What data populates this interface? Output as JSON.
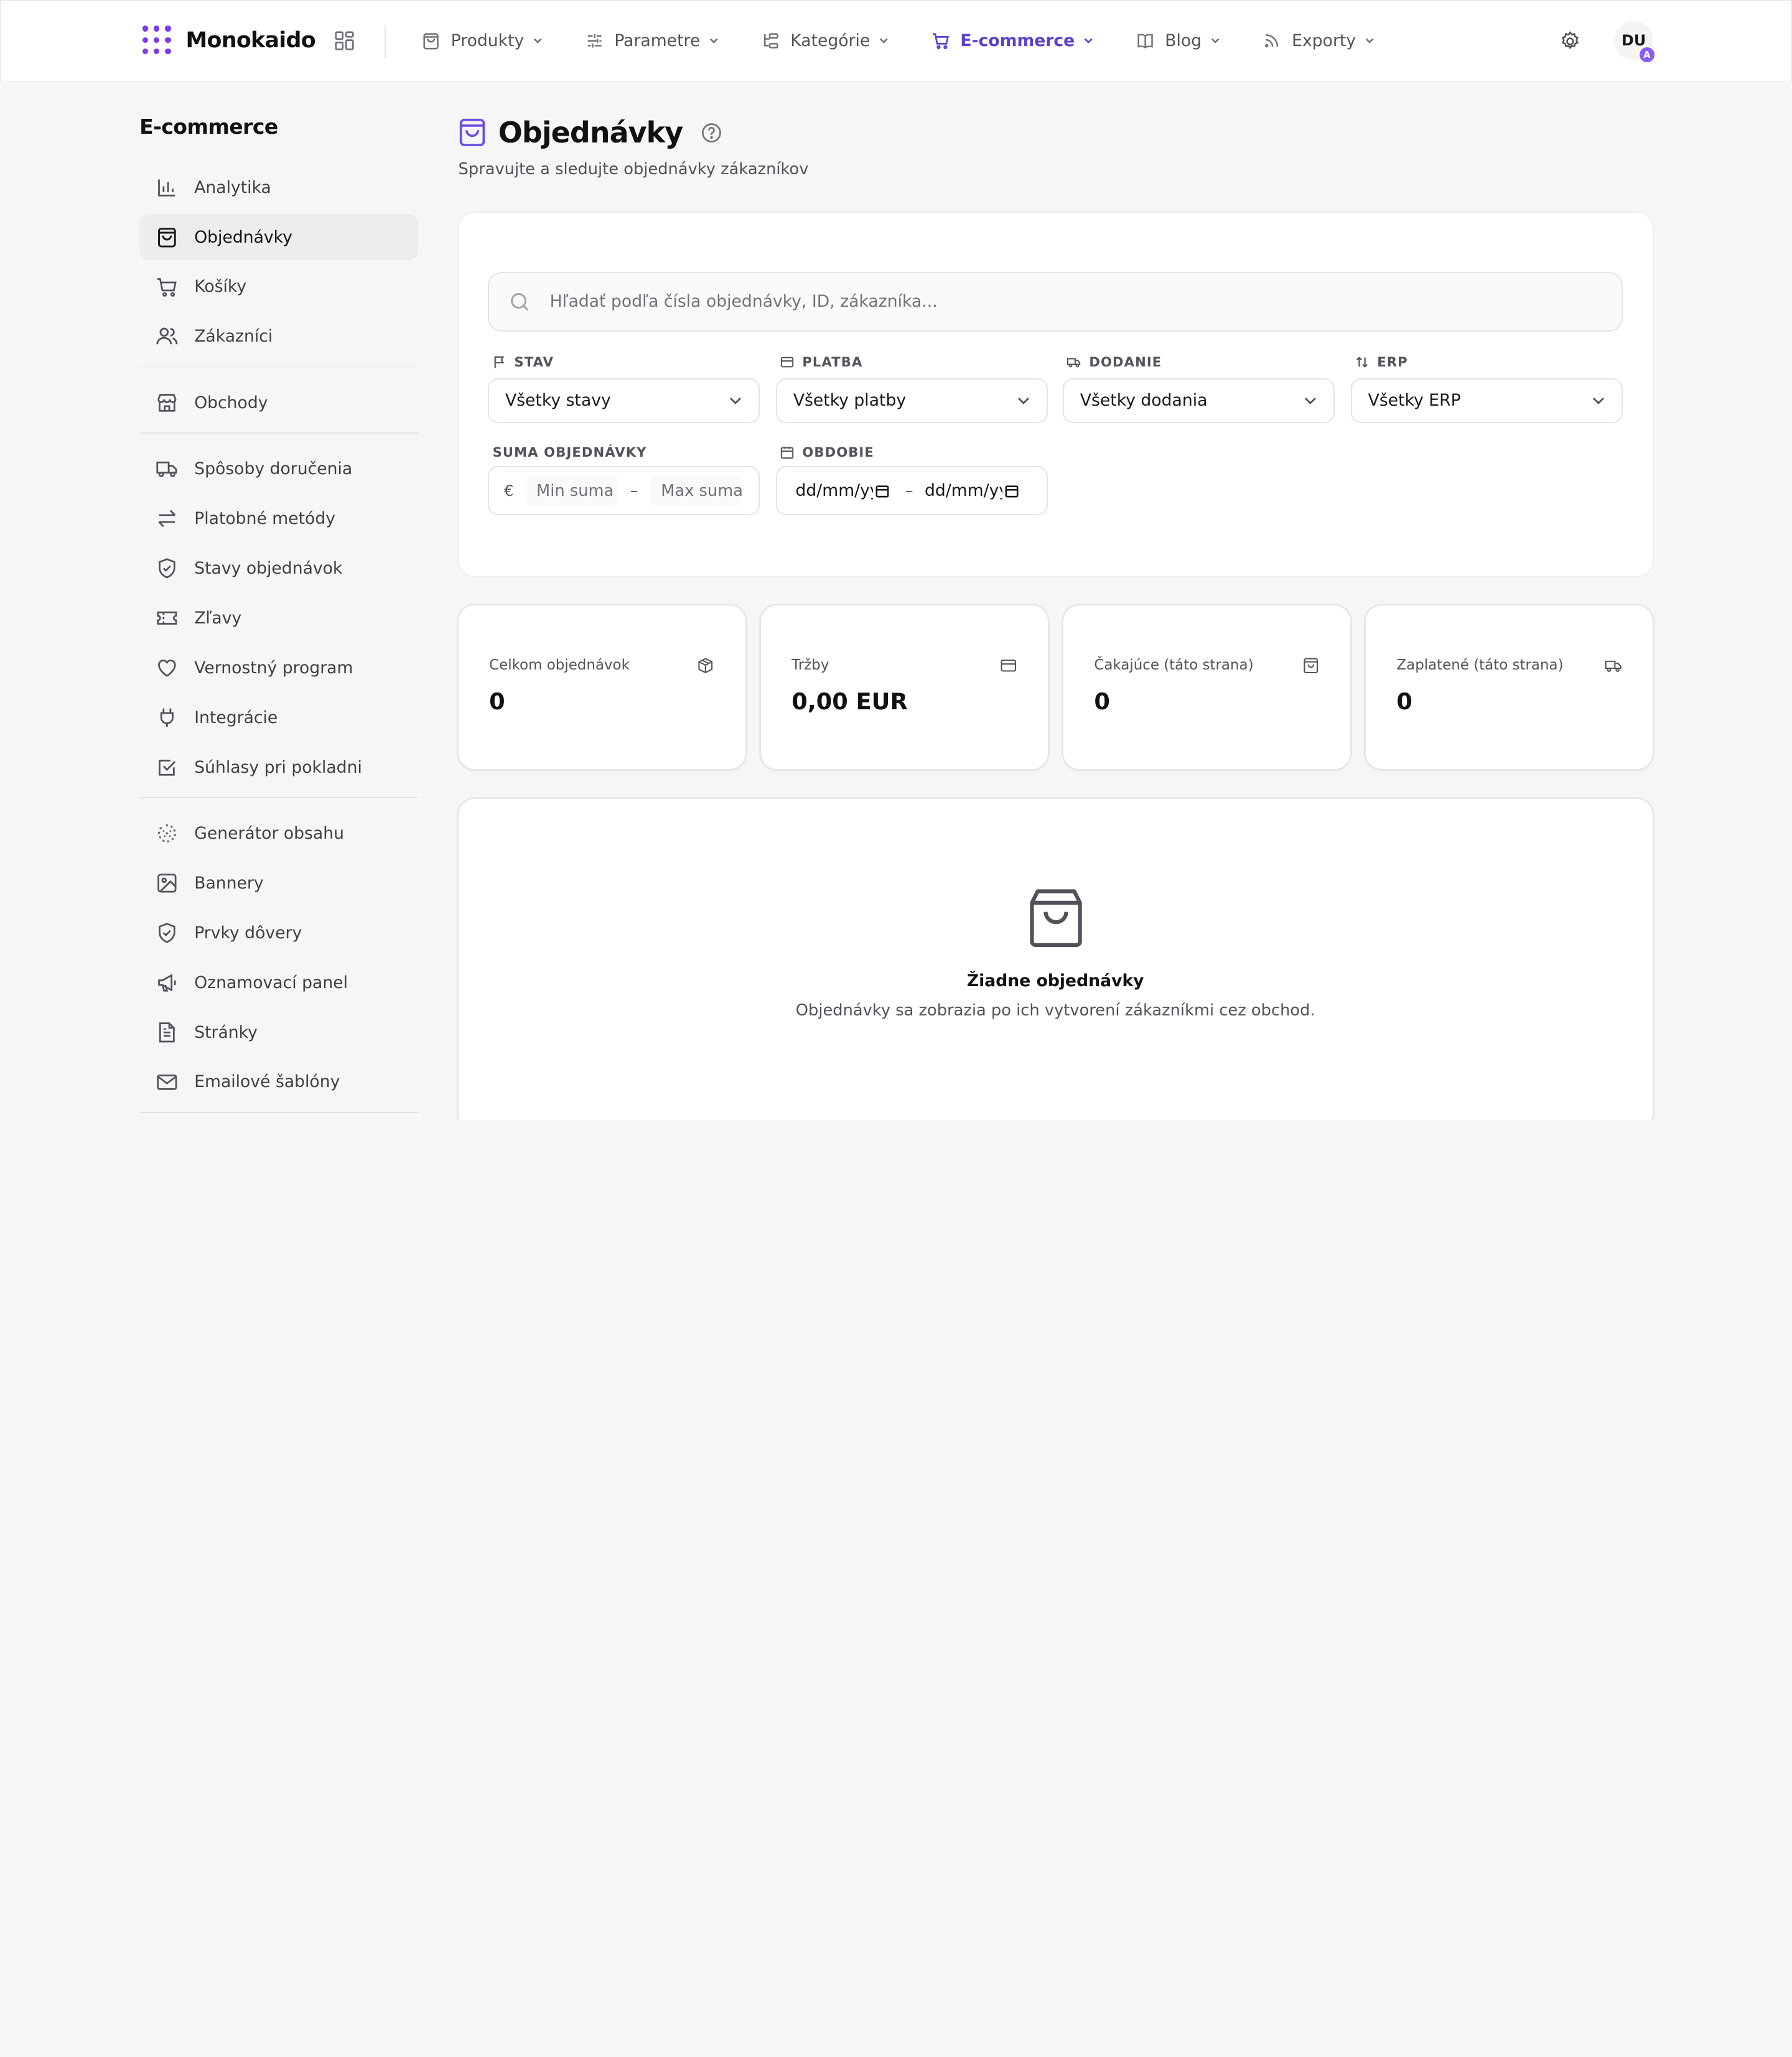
{
  "brand": {
    "name": "Monokaido"
  },
  "nav": {
    "items": [
      {
        "label": "Produkty",
        "icon": "bag-icon"
      },
      {
        "label": "Parametre",
        "icon": "sliders-icon"
      },
      {
        "label": "Kategórie",
        "icon": "tree-icon"
      },
      {
        "label": "E-commerce",
        "icon": "cart-icon",
        "active": true
      },
      {
        "label": "Blog",
        "icon": "book-icon"
      },
      {
        "label": "Exporty",
        "icon": "rss-icon"
      }
    ],
    "active_color": "#5b3fcf"
  },
  "user": {
    "initials": "DU",
    "badge": "A",
    "badge_color": "#8b5cf6"
  },
  "sidebar": {
    "title": "E-commerce",
    "items": [
      {
        "label": "Analytika"
      },
      {
        "label": "Objednávky",
        "active": true
      },
      {
        "label": "Košíky"
      },
      {
        "label": "Zákazníci"
      },
      {
        "label": "Obchody"
      },
      {
        "label": "Spôsoby doručenia"
      },
      {
        "label": "Platobné metódy"
      },
      {
        "label": "Stavy objednávok"
      },
      {
        "label": "Zľavy"
      },
      {
        "label": "Vernostný program"
      },
      {
        "label": "Integrácie"
      },
      {
        "label": "Súhlasy pri pokladni"
      },
      {
        "label": "Generátor obsahu"
      },
      {
        "label": "Bannery"
      },
      {
        "label": "Prvky dôvery"
      },
      {
        "label": "Oznamovací panel"
      },
      {
        "label": "Stránky"
      },
      {
        "label": "Emailové šablóny"
      }
    ]
  },
  "page": {
    "title": "Objednávky",
    "subtitle": "Spravujte a sledujte objednávky zákazníkov"
  },
  "filters": {
    "search_placeholder": "Hľadať podľa čísla objednávky, ID, zákazníka...",
    "status": {
      "label": "STAV",
      "value": "Všetky stavy"
    },
    "payment": {
      "label": "PLATBA",
      "value": "Všetky platby"
    },
    "delivery": {
      "label": "DODANIE",
      "value": "Všetky dodania"
    },
    "erp": {
      "label": "ERP",
      "value": "Všetky ERP"
    },
    "amount": {
      "label": "SUMA OBJEDNÁVKY",
      "currency": "€",
      "min_placeholder": "Min suma",
      "max_placeholder": "Max suma",
      "separator": "–"
    },
    "period": {
      "label": "OBDOBIE",
      "from": "dd/mm/yyyy",
      "to": "dd/mm/yyyy",
      "separator": "–"
    }
  },
  "stats": [
    {
      "label": "Celkom objednávok",
      "value": "0",
      "icon": "box-icon"
    },
    {
      "label": "Tržby",
      "value": "0,00 EUR",
      "icon": "card-icon"
    },
    {
      "label": "Čakajúce (táto strana)",
      "value": "0",
      "icon": "bag-icon"
    },
    {
      "label": "Zaplatené (táto strana)",
      "value": "0",
      "icon": "truck-icon"
    }
  ],
  "empty_state": {
    "title": "Žiadne objednávky",
    "message": "Objednávky sa zobrazia po ich vytvorení zákazníkmi cez obchod."
  }
}
